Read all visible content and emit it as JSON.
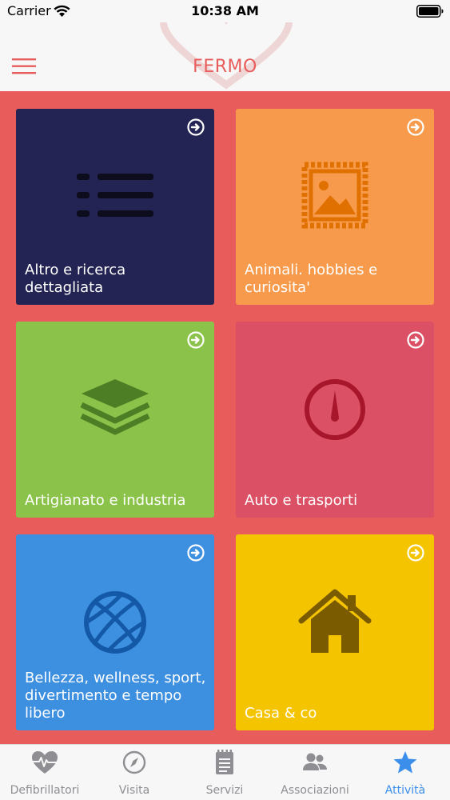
{
  "status_bar": {
    "carrier": "Carrier",
    "time": "10:38 AM"
  },
  "header": {
    "title": "FERMO",
    "menu_icon": "hamburger-menu-icon",
    "accent_color": "#e85c5c"
  },
  "tiles": [
    {
      "label": "Altro e ricerca dettagliata",
      "icon": "list-icon",
      "color": "#232453"
    },
    {
      "label": "Animali. hobbies e curiosita'",
      "icon": "picture-stamp-icon",
      "color": "#f79a4b"
    },
    {
      "label": "Artigianato e industria",
      "icon": "layers-icon",
      "color": "#8bc34a"
    },
    {
      "label": "Auto e trasporti",
      "icon": "compass-gauge-icon",
      "color": "#db5064"
    },
    {
      "label": "Bellezza, wellness, sport, divertimento e tempo libero",
      "icon": "basketball-icon",
      "color": "#3d8fe0"
    },
    {
      "label": "Casa & co",
      "icon": "house-icon",
      "color": "#f5c400"
    }
  ],
  "tab_bar": {
    "items": [
      {
        "label": "Defibrillatori",
        "icon": "heart-pulse-icon",
        "active": false
      },
      {
        "label": "Visita",
        "icon": "compass-icon",
        "active": false
      },
      {
        "label": "Servizi",
        "icon": "notepad-icon",
        "active": false
      },
      {
        "label": "Associazioni",
        "icon": "group-icon",
        "active": false
      },
      {
        "label": "Attività",
        "icon": "star-icon",
        "active": true
      }
    ],
    "active_color": "#3b8eea",
    "inactive_color": "#8e8e93"
  }
}
